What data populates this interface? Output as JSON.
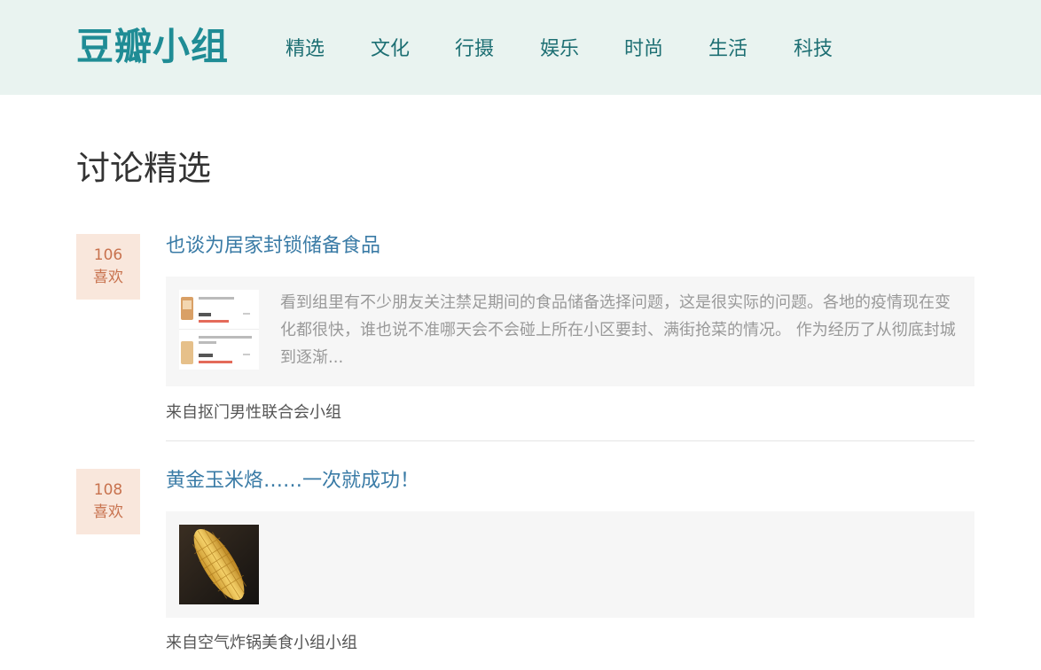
{
  "header": {
    "logo": "豆瓣小组",
    "nav": [
      "精选",
      "文化",
      "行摄",
      "娱乐",
      "时尚",
      "生活",
      "科技"
    ]
  },
  "main": {
    "section_title": "讨论精选",
    "posts": [
      {
        "likes_count": "106",
        "likes_label": "喜欢",
        "title": "也谈为居家封锁储备食品",
        "excerpt": "看到组里有不少朋友关注禁足期间的食品储备选择问题，这是很实际的问题。各地的疫情现在变化都很快，谁也说不准哪天会不会碰上所在小区要封、满街抢菜的情况。 作为经历了从彻底封城到逐渐...",
        "thumbnail_icon": "shopping-list-screenshot-thumbnail",
        "source": "来自抠门男性联合会小组"
      },
      {
        "likes_count": "108",
        "likes_label": "喜欢",
        "title": "黄金玉米烙……一次就成功！",
        "thumbnail_icon": "corn-photo-thumbnail",
        "source": "来自空气炸锅美食小组小组"
      }
    ]
  },
  "colors": {
    "header_bg": "#e9f3f0",
    "logo": "#1f8c95",
    "nav_text": "#1d6f73",
    "post_title": "#3a7ba6",
    "likes_bg": "#f9e7dc",
    "likes_text": "#c8724e"
  }
}
